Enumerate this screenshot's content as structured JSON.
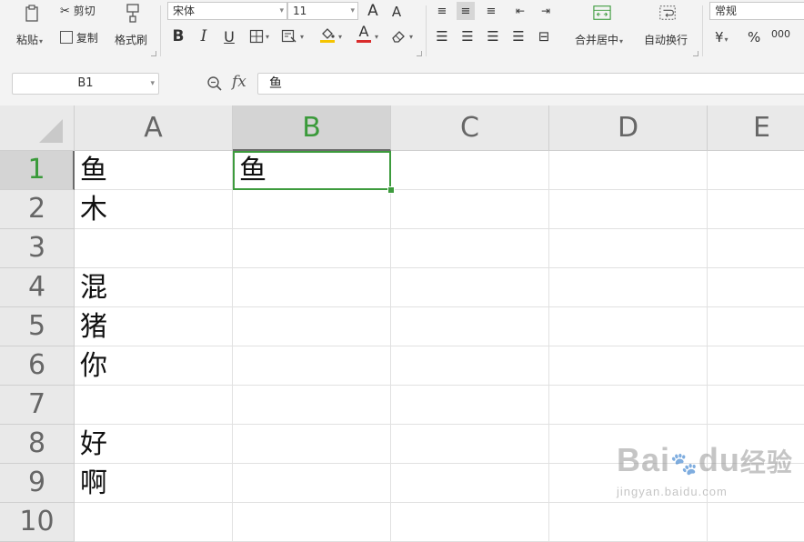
{
  "ribbon": {
    "clipboard": {
      "paste_label": "粘贴",
      "cut_label": "剪切",
      "copy_label": "复制",
      "format_painter_label": "格式刷"
    },
    "font": {
      "font_name": "宋体",
      "font_size": "11",
      "bold": "B",
      "italic": "I",
      "underline": "U",
      "increase_size": "A",
      "decrease_size": "A",
      "font_color_glyph": "A"
    },
    "alignment": {
      "merge_center_label": "合并居中",
      "wrap_text_label": "自动换行"
    },
    "number": {
      "format_value": "常规",
      "currency_symbol": "¥",
      "percent_symbol": "%",
      "thousands_symbol": "000"
    },
    "colors": {
      "font_color_bar": "#d92b2b",
      "fill_color_bar": "#f5c400"
    }
  },
  "formula_bar": {
    "name_box": "B1",
    "fx_label": "fx",
    "formula_value": "鱼"
  },
  "sheet": {
    "columns": [
      "A",
      "B",
      "C",
      "D",
      "E"
    ],
    "active_column": "B",
    "rows": [
      "1",
      "2",
      "3",
      "4",
      "5",
      "6",
      "7",
      "8",
      "9",
      "10"
    ],
    "active_row": "1",
    "column_a_values": [
      "鱼",
      "木",
      "",
      "混",
      "猪",
      "你",
      "",
      "好",
      "啊",
      ""
    ],
    "b1_value": "鱼",
    "selection_color": "#3d9b3d"
  },
  "watermark": {
    "logo_left": "Bai",
    "logo_right": "du",
    "logo_cn": "经验",
    "url": "jingyan.baidu.com"
  }
}
